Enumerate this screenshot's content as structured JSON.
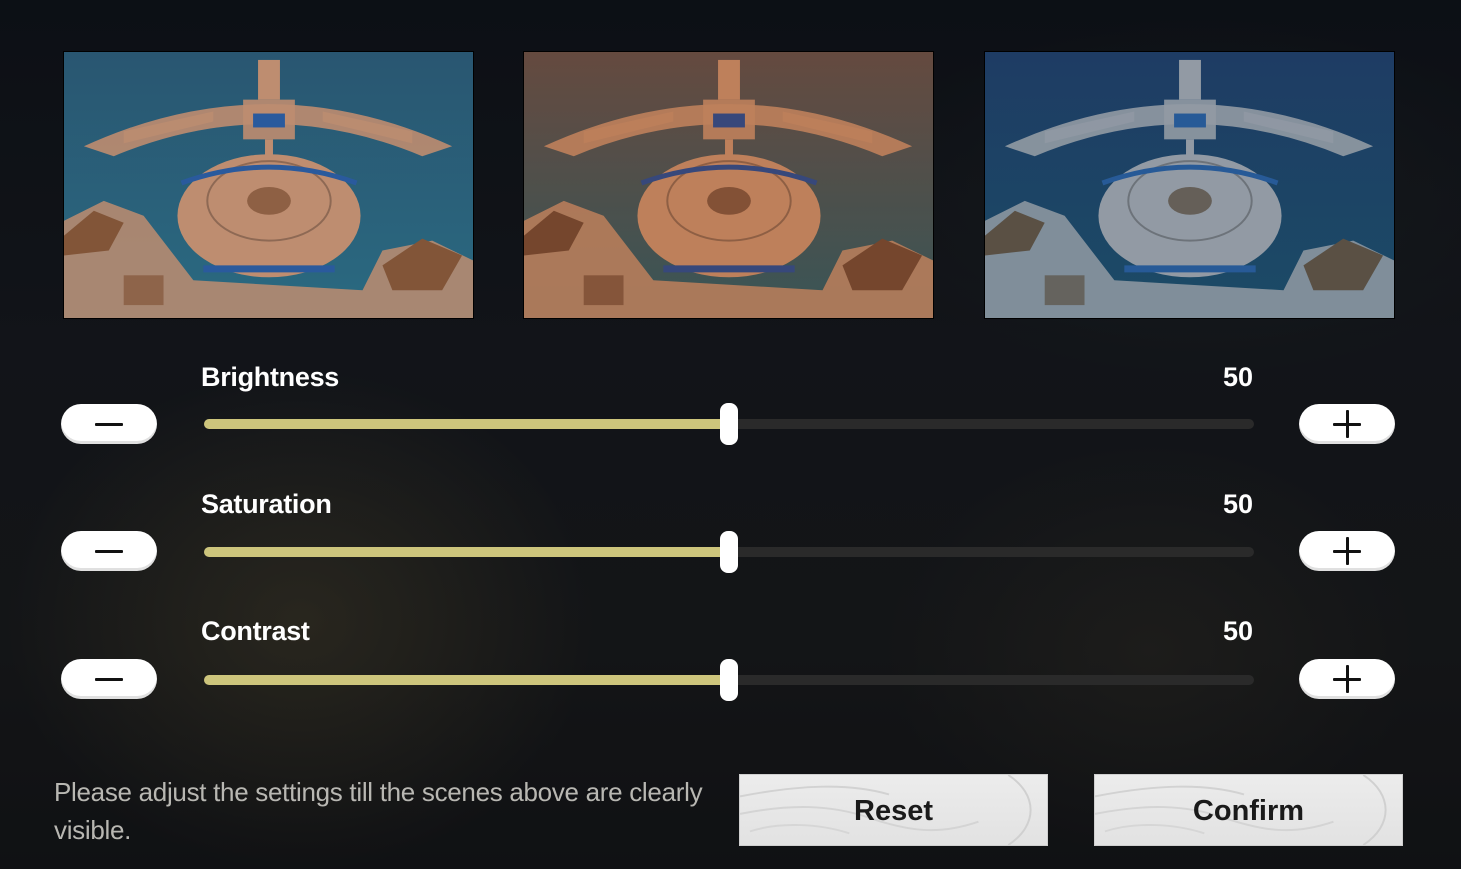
{
  "previews": [
    {
      "name": "preview-normal",
      "sky": "#2c5b78",
      "water": "#2d7088",
      "stone": "#c99577",
      "roof": "#8a5a3c",
      "accent": "#2d5fa6"
    },
    {
      "name": "preview-warm",
      "sky": "#6b4f43",
      "water": "#3c5a5c",
      "stone": "#c98760",
      "roof": "#7c4a30",
      "accent": "#3a4c82"
    },
    {
      "name": "preview-dark",
      "sky": "#20406a",
      "water": "#1d4f6c",
      "stone": "#9aa3ad",
      "roof": "#5f5548",
      "accent": "#2a5fa0"
    }
  ],
  "sliders": [
    {
      "label": "Brightness",
      "value": "50",
      "fraction": 0.5
    },
    {
      "label": "Saturation",
      "value": "50",
      "fraction": 0.5
    },
    {
      "label": "Contrast",
      "value": "50",
      "fraction": 0.5
    }
  ],
  "instruction": "Please adjust the settings till the scenes above are clearly visible.",
  "buttons": {
    "reset": "Reset",
    "confirm": "Confirm"
  },
  "colors": {
    "slider_fill": "#cdc57c",
    "slider_track": "#2a2a2a"
  }
}
